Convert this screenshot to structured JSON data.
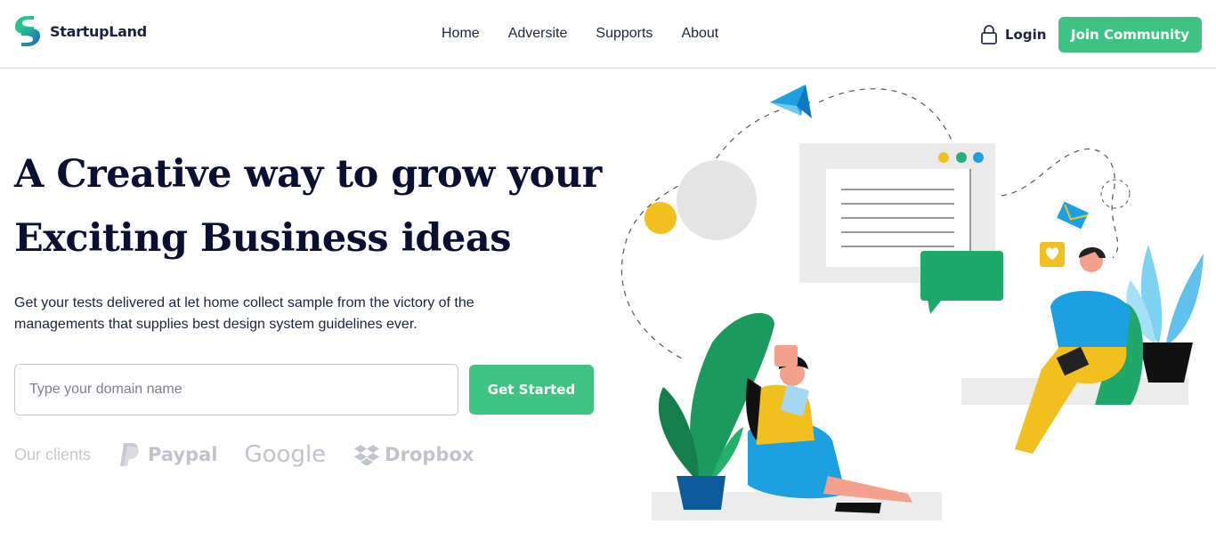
{
  "header": {
    "brand": "StartupLand",
    "nav": [
      "Home",
      "Adversite",
      "Supports",
      "About"
    ],
    "login_label": "Login",
    "join_label": "Join Community"
  },
  "hero": {
    "title_line1": "A Creative way to grow your",
    "title_line2": "Exciting Business ideas",
    "description_line1": "Get your tests delivered at let home collect sample from the victory of the",
    "description_line2": "managements that supplies best design system guidelines ever.",
    "input_placeholder": "Type your domain name",
    "cta_label": "Get Started"
  },
  "clients": {
    "label": "Our clients",
    "logos": [
      {
        "name": "Paypal",
        "icon": "paypal-icon"
      },
      {
        "name": "Google",
        "icon": "google-icon"
      },
      {
        "name": "Dropbox",
        "icon": "dropbox-icon"
      }
    ]
  },
  "colors": {
    "accent": "#3ec383",
    "heading": "#0b1033",
    "muted": "#bfc3cb"
  }
}
